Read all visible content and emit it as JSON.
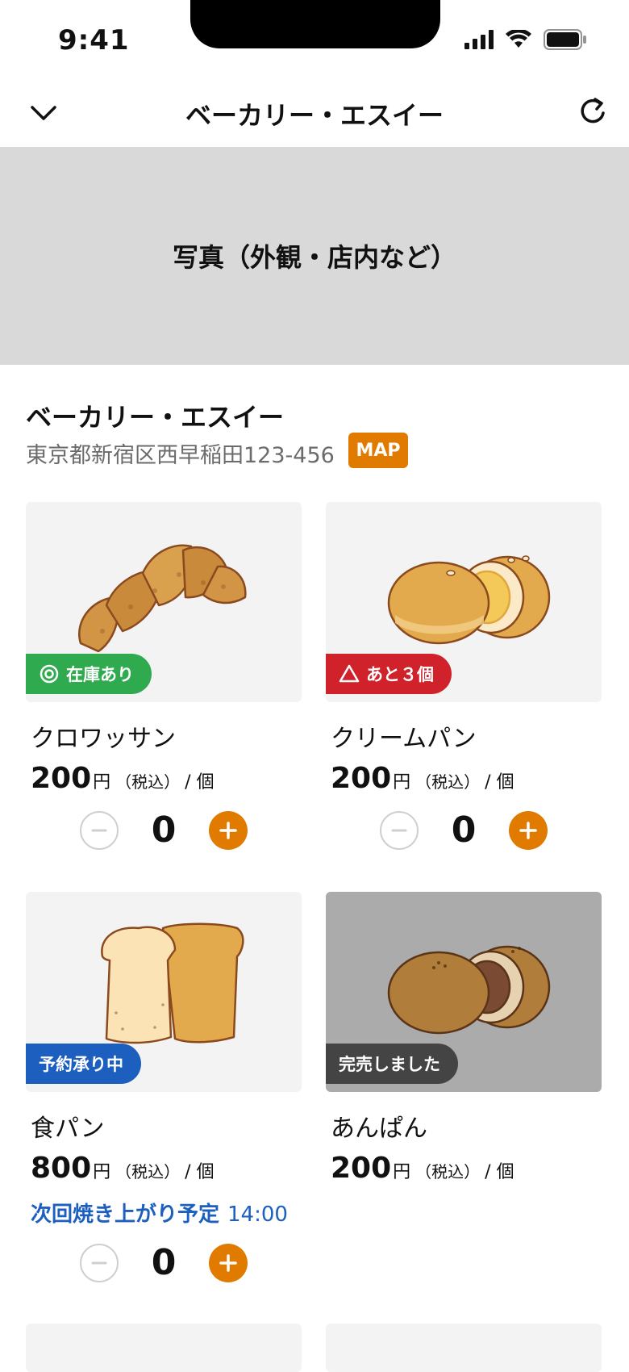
{
  "status_bar": {
    "time": "9:41"
  },
  "nav": {
    "title": "ベーカリー・エスイー"
  },
  "hero": {
    "text": "写真（外観・店内など）"
  },
  "shop": {
    "name": "ベーカリー・エスイー",
    "address": "東京都新宿区西早稲田123-456",
    "map_label": "MAP"
  },
  "price_format": {
    "unit": "円",
    "tax": "（税込）",
    "per": "/ 個"
  },
  "products": [
    {
      "name": "クロワッサン",
      "price": "200",
      "badge": "在庫あり",
      "quantity": "0"
    },
    {
      "name": "クリームパン",
      "price": "200",
      "badge": "あと３個",
      "quantity": "0"
    },
    {
      "name": "食パン",
      "price": "800",
      "badge": "予約承り中",
      "quantity": "0",
      "next_bake_label": "次回焼き上がり予定",
      "next_bake_time": "14:00"
    },
    {
      "name": "あんぱん",
      "price": "200",
      "badge": "完売しました"
    }
  ],
  "colors": {
    "accent": "#e07b00",
    "in_stock": "#2faa4f",
    "low_stock": "#d0222a",
    "reserve": "#1d5fbf",
    "sold_out": "#444444"
  }
}
